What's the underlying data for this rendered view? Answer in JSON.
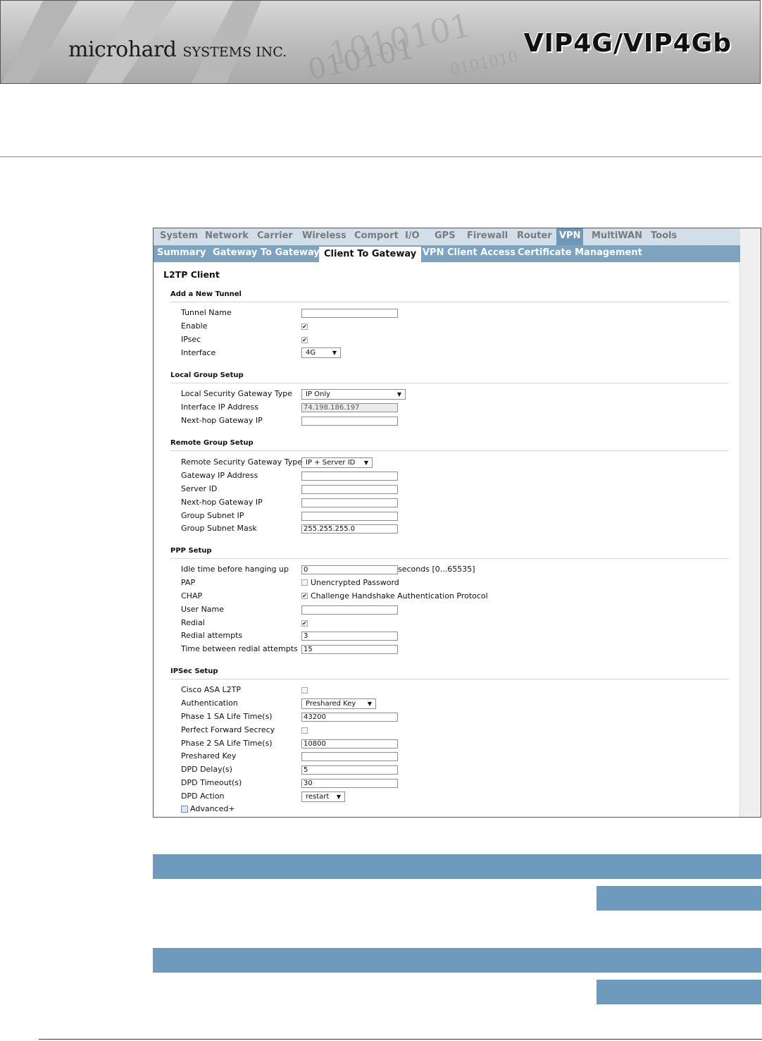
{
  "banner": {
    "company": "microhard",
    "company_suffix": "SYSTEMS INC.",
    "product": "VIP4G/VIP4Gb"
  },
  "menu": {
    "primary": [
      "System",
      "Network",
      "Carrier",
      "Wireless",
      "Comport",
      "I/O",
      "GPS",
      "Firewall",
      "Router",
      "VPN",
      "MultiWAN",
      "Tools"
    ],
    "primary_active": "VPN",
    "secondary": [
      "Summary",
      "Gateway To Gateway",
      "Client To Gateway",
      "VPN Client Access",
      "Certificate Management"
    ],
    "secondary_active": "Client To Gateway"
  },
  "page_title": "L2TP Client",
  "add_tunnel": {
    "heading": "Add a New Tunnel",
    "tunnel_name_label": "Tunnel Name",
    "tunnel_name_value": "",
    "enable_label": "Enable",
    "enable_checked": true,
    "ipsec_label": "IPsec",
    "ipsec_checked": true,
    "interface_label": "Interface",
    "interface_value": "4G"
  },
  "local_group": {
    "heading": "Local Group Setup",
    "gateway_type_label": "Local Security Gateway Type",
    "gateway_type_value": "IP Only",
    "interface_ip_label": "Interface IP Address",
    "interface_ip_value": "74.198.186.197",
    "next_hop_label": "Next-hop Gateway IP",
    "next_hop_value": ""
  },
  "remote_group": {
    "heading": "Remote Group Setup",
    "gateway_type_label": "Remote Security Gateway Type",
    "gateway_type_value": "IP + Server ID",
    "gateway_ip_label": "Gateway IP Address",
    "gateway_ip_value": "",
    "server_id_label": "Server ID",
    "server_id_value": "",
    "next_hop_label": "Next-hop Gateway IP",
    "next_hop_value": "",
    "subnet_ip_label": "Group Subnet IP",
    "subnet_ip_value": "",
    "subnet_mask_label": "Group Subnet Mask",
    "subnet_mask_value": "255.255.255.0"
  },
  "ppp": {
    "heading": "PPP Setup",
    "idle_label": "Idle time before hanging up",
    "idle_value": "0",
    "idle_suffix": "seconds [0...65535]",
    "pap_label": "PAP",
    "pap_checked": false,
    "pap_text": "Unencrypted Password",
    "chap_label": "CHAP",
    "chap_checked": true,
    "chap_text": "Challenge Handshake Authentication Protocol",
    "user_label": "User Name",
    "user_value": "",
    "redial_label": "Redial",
    "redial_checked": true,
    "redial_attempts_label": "Redial attempts",
    "redial_attempts_value": "3",
    "redial_time_label": "Time between redial attempts",
    "redial_time_value": "15"
  },
  "ipsec": {
    "heading": "IPSec Setup",
    "cisco_label": "Cisco ASA L2TP",
    "cisco_checked": false,
    "auth_label": "Authentication",
    "auth_value": "Preshared Key",
    "phase1_label": "Phase 1 SA Life Time(s)",
    "phase1_value": "43200",
    "pfs_label": "Perfect Forward Secrecy",
    "pfs_checked": false,
    "phase2_label": "Phase 2 SA Life Time(s)",
    "phase2_value": "10800",
    "psk_label": "Preshared Key",
    "psk_value": "",
    "dpd_delay_label": "DPD Delay(s)",
    "dpd_delay_value": "5",
    "dpd_timeout_label": "DPD Timeout(s)",
    "dpd_timeout_value": "30",
    "dpd_action_label": "DPD Action",
    "dpd_action_value": "restart",
    "advanced_label": "Advanced+"
  },
  "colors": {
    "accent_bar": "#6e9bbd",
    "menu_primary": "#d3dfe8",
    "menu_secondary": "#7ea3be"
  }
}
